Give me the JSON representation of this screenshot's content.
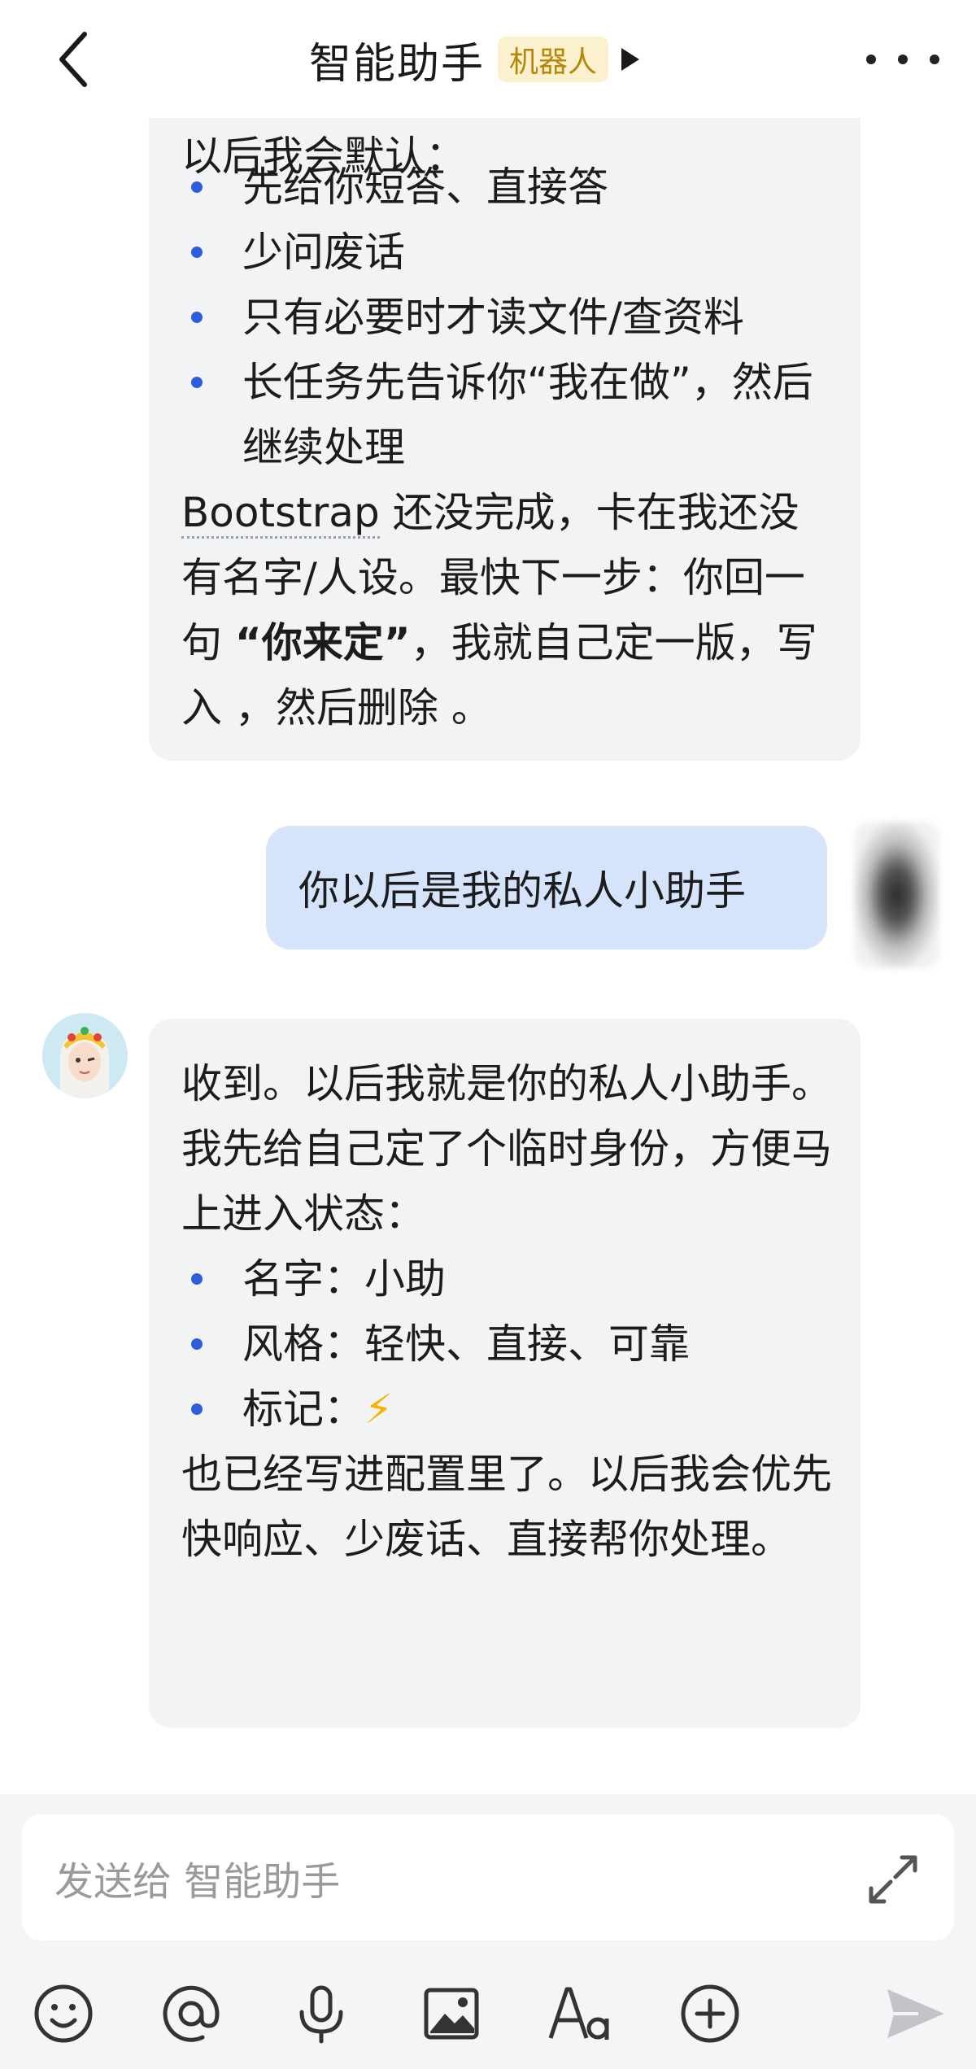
{
  "header": {
    "title": "智能助手",
    "badge": "机器人"
  },
  "messages": [
    {
      "role": "bot",
      "partial_line": "以后我会默认：",
      "items": [
        "先给你短答、直接答",
        "少问废话",
        "只有必要时才读文件/查资料",
        "长任务先告诉你“我在做”，然后继续处理"
      ],
      "para_a": "Bootstrap",
      "para_b": " 还没完成，卡在我还没有名字/人设。最快下一步：你回一句 ",
      "para_bold": "“你来定”",
      "para_c": "，我就自己定一版，写入 ，然后删除 。"
    },
    {
      "role": "user",
      "text": "你以后是我的私人小助手"
    },
    {
      "role": "bot",
      "line1": "收到。以后我就是你的私人小助手。",
      "line2": "我先给自己定了个临时身份，方便马上进入状态：",
      "items": [
        "名字：小助",
        "风格：轻快、直接、可靠",
        "标记："
      ],
      "bolt": "⚡",
      "line3": "也已经写进配置里了。以后我会优先快响应、少废话、直接帮你处理。"
    }
  ],
  "composer": {
    "placeholder": "发送给 智能助手"
  },
  "toolbar_icons": [
    "emoji-icon",
    "at-icon",
    "microphone-icon",
    "image-icon",
    "text-format-icon",
    "plus-icon",
    "send-icon"
  ],
  "colors": {
    "bubble_bot": "#f2f3f5",
    "bubble_user": "#d6e4fb",
    "bullet": "#2b5fd9",
    "badge_bg": "#fbf1cf",
    "badge_text": "#b8860b"
  }
}
